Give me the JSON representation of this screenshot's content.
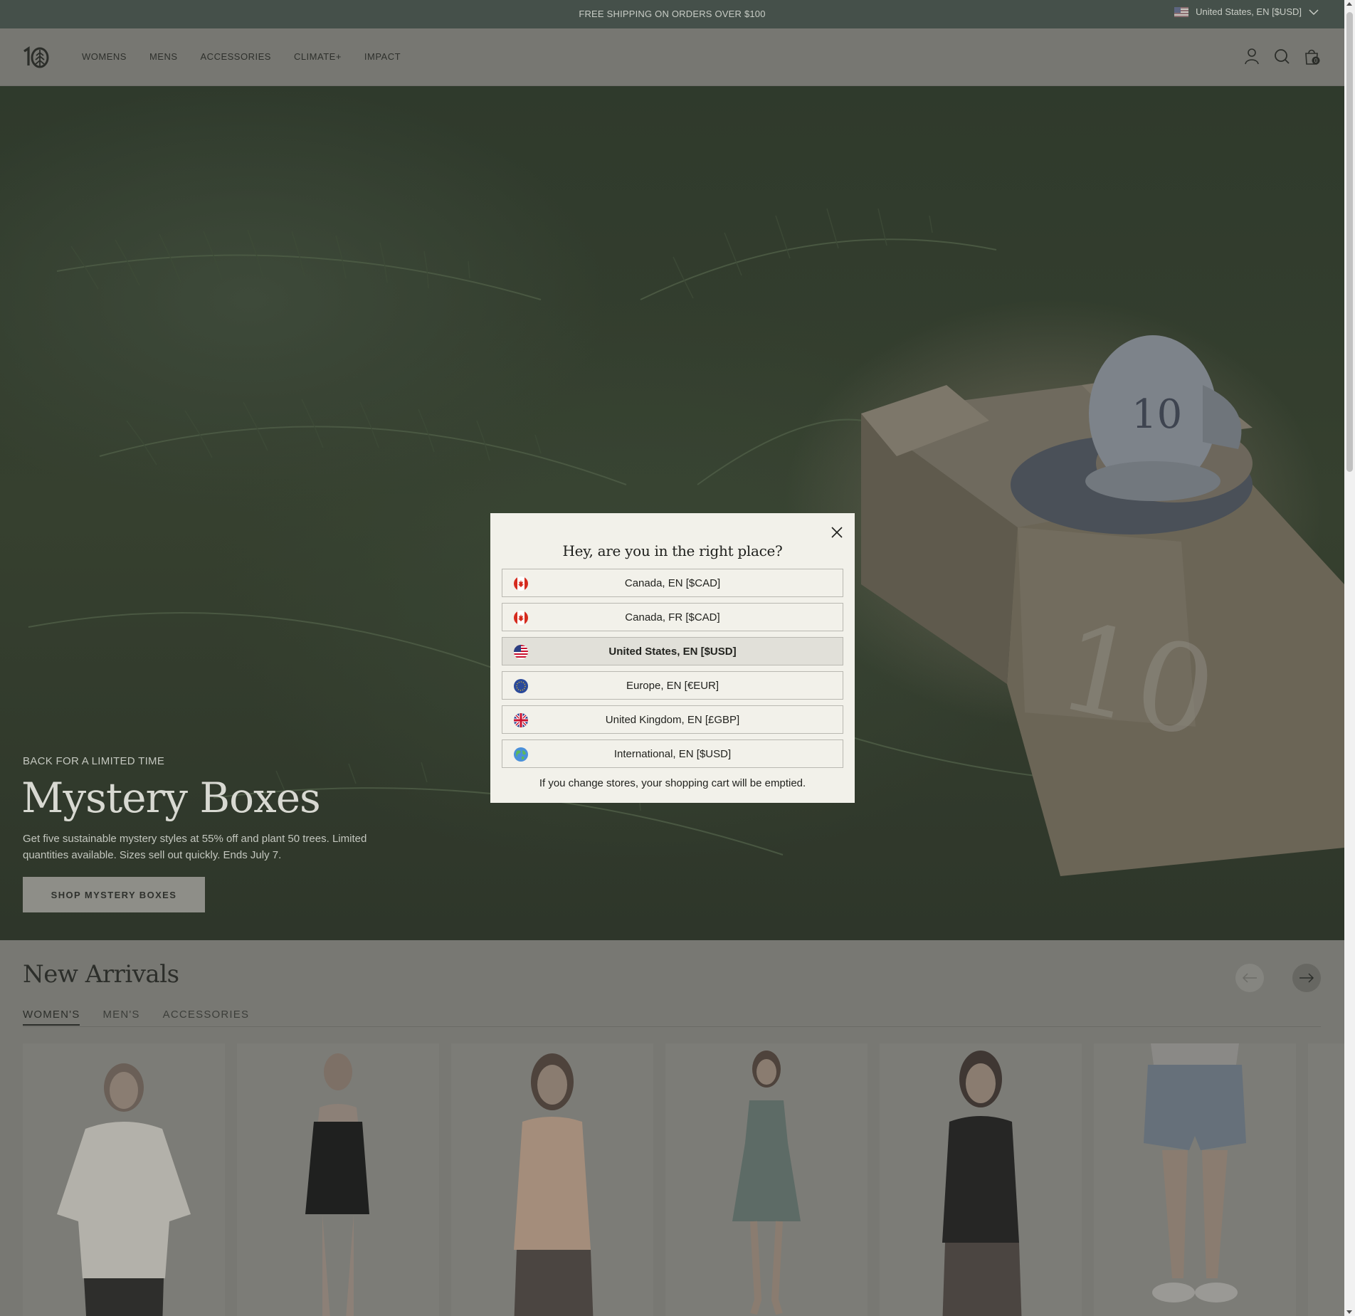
{
  "announcement": {
    "text": "FREE SHIPPING ON ORDERS OVER $100",
    "locale_label": "United States, EN [$USD]"
  },
  "header": {
    "nav": [
      "WOMENS",
      "MENS",
      "ACCESSORIES",
      "CLIMATE+",
      "IMPACT"
    ],
    "cart_count": "0"
  },
  "hero": {
    "eyebrow": "BACK FOR A LIMITED TIME",
    "title": "Mystery Boxes",
    "description": "Get five sustainable mystery styles at 55% off and plant 50 trees. Limited quantities available. Sizes sell out quickly. Ends July 7.",
    "cta": "SHOP MYSTERY BOXES"
  },
  "arrivals": {
    "title": "New Arrivals",
    "tabs": [
      "WOMEN'S",
      "MEN'S",
      "ACCESSORIES"
    ],
    "active_tab": 0
  },
  "modal": {
    "title": "Hey, are you in the right place?",
    "options": [
      {
        "label": "Canada, EN [$CAD]",
        "flag": "canada-flag-icon",
        "selected": false
      },
      {
        "label": "Canada, FR [$CAD]",
        "flag": "canada-flag-icon",
        "selected": false
      },
      {
        "label": "United States, EN [$USD]",
        "flag": "us-flag-icon",
        "selected": true
      },
      {
        "label": "Europe, EN [€EUR]",
        "flag": "eu-flag-icon",
        "selected": false
      },
      {
        "label": "United Kingdom, EN [£GBP]",
        "flag": "uk-flag-icon",
        "selected": false
      },
      {
        "label": "International, EN [$USD]",
        "flag": "globe-icon",
        "selected": false
      }
    ],
    "note": "If you change stores, your shopping cart will be emptied."
  },
  "colors": {
    "overlay_dim": "#000000",
    "modal_bg": "#f2f1ea",
    "selected_option_bg": "#e1e0d9"
  }
}
